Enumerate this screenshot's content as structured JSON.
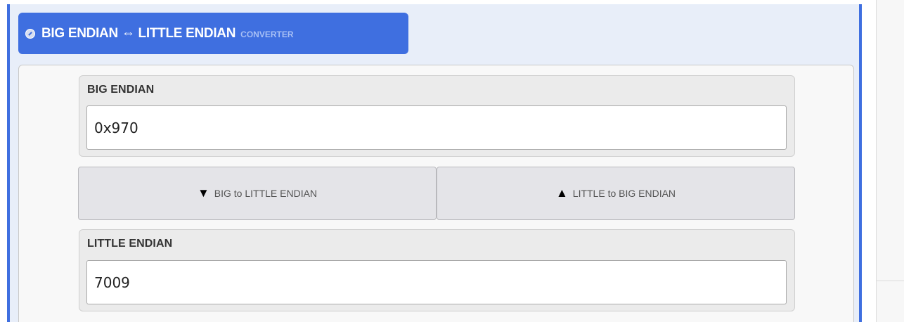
{
  "title": {
    "main": "BIG ENDIAN ⇔ LITTLE ENDIAN",
    "sub": "CONVERTER"
  },
  "big_endian": {
    "label": "BIG ENDIAN",
    "value": "0x970"
  },
  "buttons": {
    "big_to_little": {
      "arrow": "▼",
      "label": "BIG to LITTLE ENDIAN"
    },
    "little_to_big": {
      "arrow": "▲",
      "label": "LITTLE to BIG ENDIAN"
    }
  },
  "little_endian": {
    "label": "LITTLE ENDIAN",
    "value": "7009"
  },
  "colors": {
    "accent": "#3f6fe0",
    "panel_background": "#e8eef9",
    "subtitle": "#a7bff5"
  }
}
